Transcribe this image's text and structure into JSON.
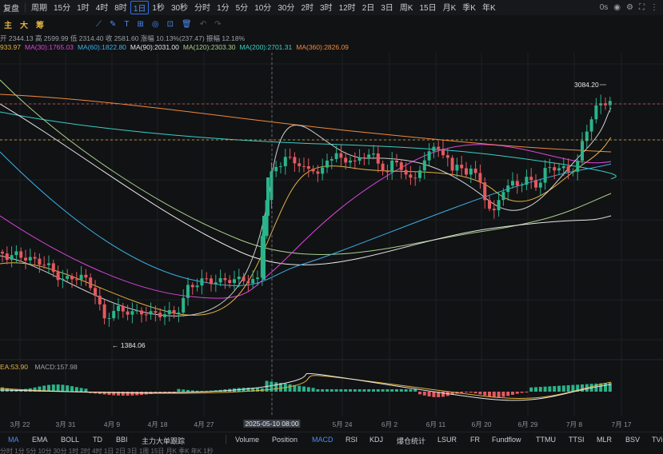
{
  "topbar": {
    "symbol": "复盘",
    "items": [
      "周期",
      "15分",
      "1时",
      "4时",
      "8时",
      "1日",
      "1秒",
      "30秒",
      "分时",
      "1分",
      "5分",
      "10分",
      "30分",
      "2时",
      "3时",
      "12时",
      "2日",
      "3日",
      "周K",
      "15日",
      "月K",
      "季K",
      "年K"
    ],
    "active": "1日",
    "right": [
      "0s"
    ]
  },
  "toolbar": {
    "markers": [
      "主",
      "大",
      "筹"
    ]
  },
  "info": {
    "text": "开 2344.13  高 2599.99  低 2314.40  收 2581.60  涨幅 10.13%(237.47)  振幅 12.18%"
  },
  "ma_lines": [
    {
      "label": "933.97",
      "color": "#e3b341"
    },
    {
      "label": "MA(30):1765.03",
      "color": "#d946d9"
    },
    {
      "label": "MA(60):1822.80",
      "color": "#3bb0e8"
    },
    {
      "label": "MA(90):2031.00",
      "color": "#e6e6e6"
    },
    {
      "label": "MA(120):2303.30",
      "color": "#a8d08d"
    },
    {
      "label": "MA(200):2701.31",
      "color": "#3ad0c7"
    },
    {
      "label": "MA(360):2826.09",
      "color": "#f08a3c"
    }
  ],
  "chart_data": {
    "type": "candlestick",
    "high_label": "3084.20",
    "low_label": "1384.06",
    "x_ticks": [
      "3月 22",
      "3月 31",
      "4月 9",
      "4月 18",
      "4月 27",
      "2025-05-10 08:00",
      "5月 24",
      "6月 2",
      "6月 11",
      "6月 20",
      "6月 29",
      "7月 8",
      "7月 17"
    ],
    "macd_labels": [
      "EA:53.90",
      "MACD:157.98"
    ]
  },
  "indicators": [
    "MA",
    "EMA",
    "BOLL",
    "TD",
    "BBI",
    "主力大单跟踪",
    "Volume",
    "Position",
    "MACD",
    "RSI",
    "KDJ",
    "爆仓统计",
    "LSUR",
    "FR",
    "Fundflow",
    "TTMU",
    "TTSI",
    "MLR",
    "BSV",
    "TVi"
  ],
  "active_indicator": "MACD",
  "bottom": "分时  1分  5分  10分  30分  1时  2时  4时  1日  2日  3日  1周  15日  月K  季K  年K  1秒"
}
